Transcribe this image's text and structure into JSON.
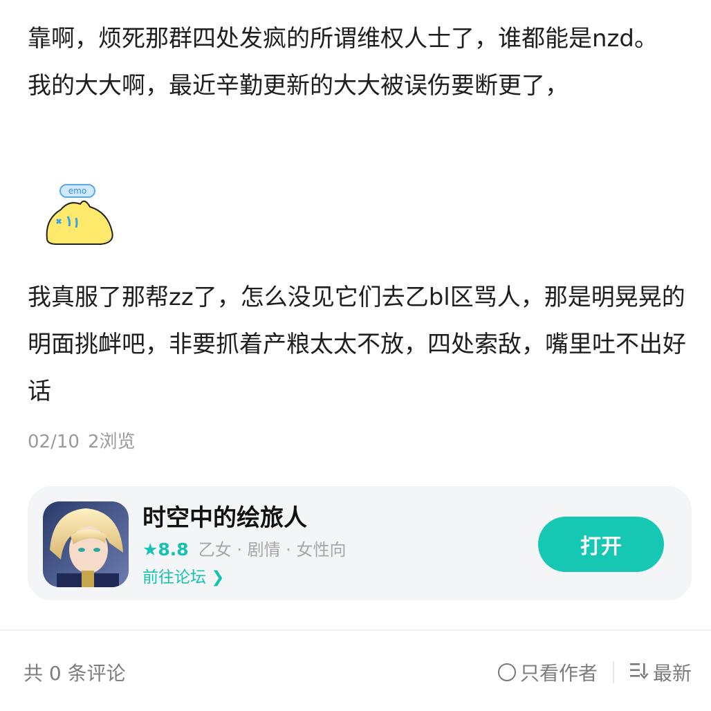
{
  "post": {
    "paragraph1": "靠啊，烦死那群四处发疯的所谓维权人士了，谁都能是nzd。",
    "paragraph2": "我的大大啊，最近辛勤更新的大大被误伤要断更了，",
    "emoji_text": "emo",
    "paragraph3": "我真服了那帮zz了，怎么没见它们去乙bl区骂人，那是明晃晃的明面挑衅吧，非要抓着产粮太太不放，四处索敌，嘴里吐不出好话",
    "date": "02/10",
    "views": "2浏览"
  },
  "app_card": {
    "name": "时空中的绘旅人",
    "rating": "★8.8",
    "tags": "乙女 · 剧情 · 女性向",
    "forum_link": "前往论坛 ❯",
    "open_button": "打开"
  },
  "footer": {
    "comment_count": "共 0 条评论",
    "author_only": "只看作者",
    "sort": "最新"
  },
  "colors": {
    "accent": "#16c8b3",
    "card_bg": "#f4f5f7",
    "meta_text": "#9a9a9a"
  },
  "icons": [
    "crying-blob-emoji",
    "app-icon-portrait",
    "radio-circle-icon",
    "sort-icon"
  ]
}
